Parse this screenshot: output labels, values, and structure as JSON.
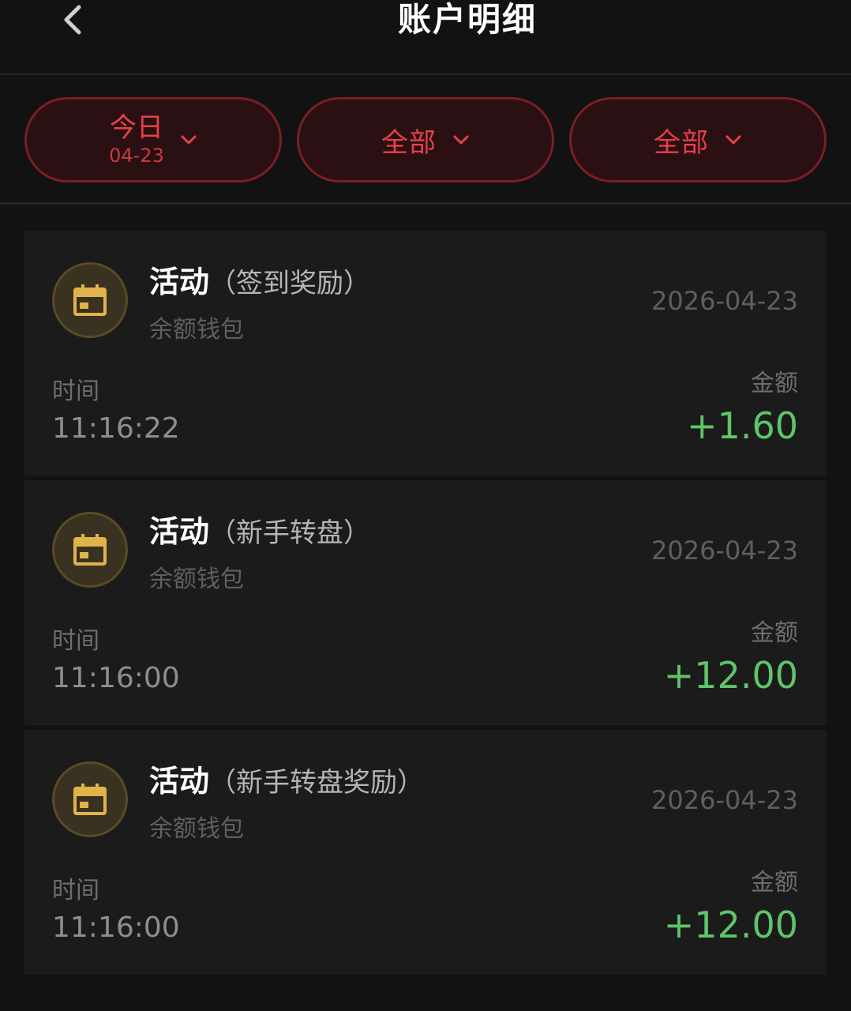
{
  "header": {
    "title": "账户明细"
  },
  "filters": [
    {
      "label": "今日",
      "sub": "04-23"
    },
    {
      "label": "全部"
    },
    {
      "label": "全部"
    }
  ],
  "colors": {
    "accent": "#e8404a",
    "positive": "#5fc46a",
    "icon_gold": "#e0b44a"
  },
  "records": [
    {
      "title": "活动",
      "subtitle": "（签到奖励）",
      "wallet": "余额钱包",
      "date": "2026-04-23",
      "time_label": "时间",
      "time": "11:16:22",
      "amount_label": "金额",
      "amount": "+1.60",
      "icon": "calendar-icon"
    },
    {
      "title": "活动",
      "subtitle": "（新手转盘）",
      "wallet": "余额钱包",
      "date": "2026-04-23",
      "time_label": "时间",
      "time": "11:16:00",
      "amount_label": "金额",
      "amount": "+12.00",
      "icon": "calendar-icon"
    },
    {
      "title": "活动",
      "subtitle": "（新手转盘奖励）",
      "wallet": "余额钱包",
      "date": "2026-04-23",
      "time_label": "时间",
      "time": "11:16:00",
      "amount_label": "金额",
      "amount": "+12.00",
      "icon": "calendar-icon"
    }
  ]
}
